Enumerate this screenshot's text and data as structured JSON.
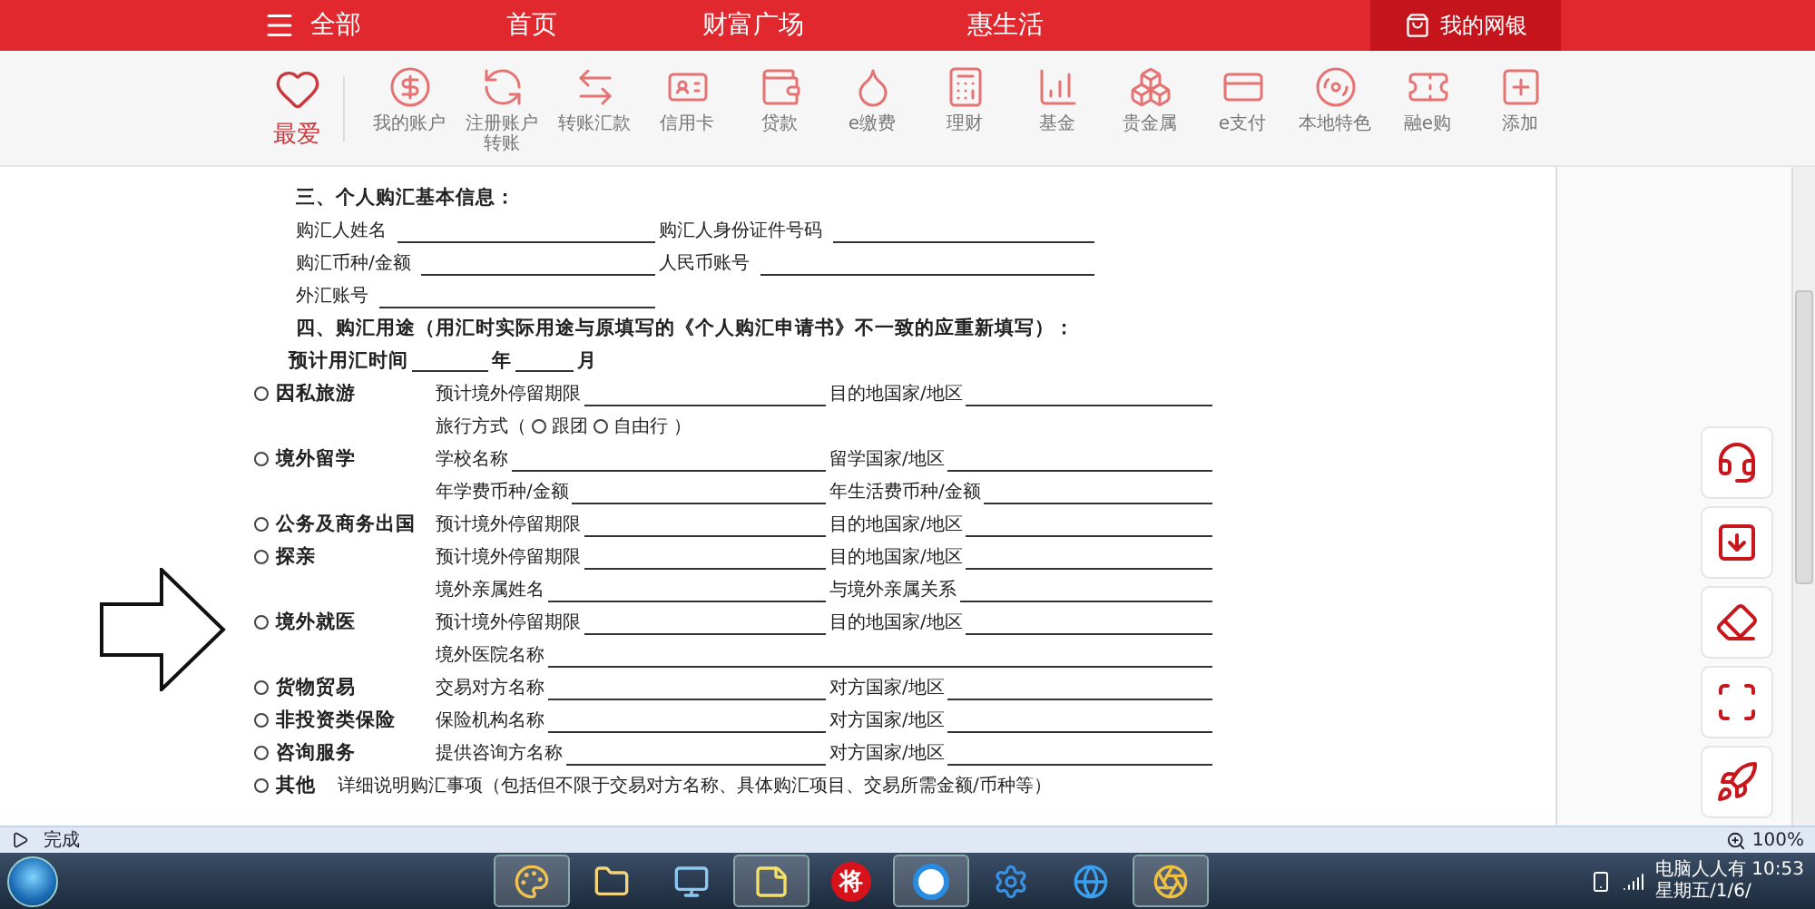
{
  "top_bar": {
    "items": [
      {
        "label": "全部",
        "kind": "menu"
      },
      {
        "label": "首页",
        "kind": "link"
      },
      {
        "label": "财富广场",
        "kind": "link"
      },
      {
        "label": "惠生活",
        "kind": "link"
      }
    ],
    "account": "我的网银"
  },
  "shortcuts": [
    {
      "label": "最爱",
      "kind": "favorite"
    },
    {
      "label": "我的账户",
      "kind": "shortcut"
    },
    {
      "label": "注册账户转账",
      "kind": "shortcut"
    },
    {
      "label": "转账汇款",
      "kind": "shortcut"
    },
    {
      "label": "信用卡",
      "kind": "shortcut"
    },
    {
      "label": "贷款",
      "kind": "shortcut"
    },
    {
      "label": "e缴费",
      "kind": "shortcut"
    },
    {
      "label": "理财",
      "kind": "shortcut"
    },
    {
      "label": "基金",
      "kind": "shortcut"
    },
    {
      "label": "贵金属",
      "kind": "shortcut"
    },
    {
      "label": "e支付",
      "kind": "shortcut"
    },
    {
      "label": "本地特色",
      "kind": "shortcut"
    },
    {
      "label": "融e购",
      "kind": "shortcut"
    },
    {
      "label": "添加",
      "kind": "shortcut"
    }
  ],
  "document": {
    "section3": {
      "title": "三、个人购汇基本信息：",
      "rows": [
        [
          "购汇人姓名",
          "购汇人身份证件号码"
        ],
        [
          "购汇币种/金额",
          "人民币账号"
        ],
        [
          "外汇账号"
        ]
      ]
    },
    "section4": {
      "title": "四、购汇用途（用汇时实际用途与原填写的《个人购汇申请书》不一致的应重新填写）：",
      "time": {
        "label": "预计用汇时间",
        "year": "年",
        "month": "月"
      },
      "purposes": [
        {
          "name": "因私旅游",
          "selected": false,
          "lines": [
            {
              "kind": "fields",
              "fields": [
                "预计境外停留期限",
                "目的地国家/地区"
              ]
            },
            {
              "kind": "choice",
              "label": "旅行方式（",
              "options": [
                {
                  "label": "跟团",
                  "selected": false
                },
                {
                  "label": "自由行",
                  "selected": false
                }
              ],
              "end": "）"
            }
          ]
        },
        {
          "name": "境外留学",
          "selected": false,
          "lines": [
            {
              "kind": "fields",
              "fields": [
                "学校名称",
                "留学国家/地区"
              ]
            },
            {
              "kind": "fields",
              "fields": [
                "年学费币种/金额",
                "年生活费币种/金额"
              ]
            }
          ]
        },
        {
          "name": "公务及商务出国",
          "selected": false,
          "lines": [
            {
              "kind": "fields",
              "fields": [
                "预计境外停留期限",
                "目的地国家/地区"
              ]
            }
          ]
        },
        {
          "name": "探亲",
          "selected": false,
          "lines": [
            {
              "kind": "fields",
              "fields": [
                "预计境外停留期限",
                "目的地国家/地区"
              ]
            },
            {
              "kind": "fields",
              "fields": [
                "境外亲属姓名",
                "与境外亲属关系"
              ]
            }
          ]
        },
        {
          "name": "境外就医",
          "selected": false,
          "lines": [
            {
              "kind": "fields",
              "fields": [
                "预计境外停留期限",
                "目的地国家/地区"
              ]
            },
            {
              "kind": "wide",
              "fields": [
                "境外医院名称"
              ]
            }
          ]
        },
        {
          "name": "货物贸易",
          "selected": false,
          "lines": [
            {
              "kind": "fields",
              "fields": [
                "交易对方名称",
                "对方国家/地区"
              ]
            }
          ]
        },
        {
          "name": "非投资类保险",
          "selected": false,
          "lines": [
            {
              "kind": "fields",
              "fields": [
                "保险机构名称",
                "对方国家/地区"
              ]
            }
          ]
        },
        {
          "name": "咨询服务",
          "selected": false,
          "lines": [
            {
              "kind": "fields",
              "fields": [
                "提供咨询方名称",
                "对方国家/地区"
              ]
            }
          ]
        },
        {
          "name": "其他",
          "selected": false,
          "lines": [
            {
              "kind": "note",
              "text": "详细说明购汇事项（包括但不限于交易对方名称、具体购汇项目、交易所需金额/币种等）"
            }
          ]
        }
      ]
    }
  },
  "status_bar": {
    "status": "完成",
    "zoom": "100%"
  },
  "taskbar": {
    "badge_char": "将",
    "tray_name": "电脑人人有",
    "time": "10:53",
    "date": "星期五/1/6/"
  }
}
